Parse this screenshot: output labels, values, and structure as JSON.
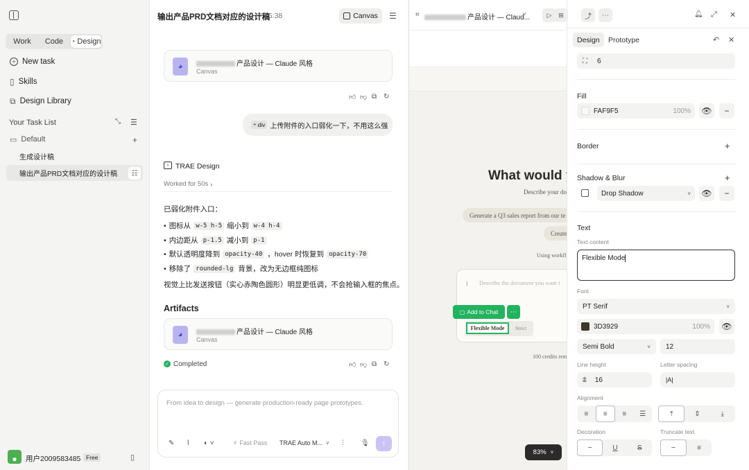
{
  "sidebar": {
    "mode_tabs": [
      "Work",
      "Code",
      "Design"
    ],
    "nav": [
      {
        "icon": "plus-circle-icon",
        "label": "New task"
      },
      {
        "icon": "book-icon",
        "label": "Skills"
      },
      {
        "icon": "library-icon",
        "label": "Design Library"
      }
    ],
    "task_list_title": "Your Task List",
    "group": "Default",
    "tasks": [
      "生成设计稿",
      "输出产品PRD文档对应的设计稿"
    ],
    "user": {
      "name": "用户2009583485",
      "plan": "Free"
    }
  },
  "chat": {
    "title": "输出产品PRD文档对应的设计稿",
    "time": "15:38",
    "canvas_label": "Canvas",
    "artifact_title": "产品设计 — Claude 风格",
    "artifact_sub": "Canvas",
    "user_msg_tag": "div",
    "user_msg": "上传附件的入口弱化一下，不用这么强",
    "agent_name": "TRAE Design",
    "worked": "Worked for 50s",
    "reply_intro": "已弱化附件入口：",
    "bullets": [
      {
        "a": "图标从 ",
        "c1": "w-5 h-5",
        "b": " 缩小到 ",
        "c2": "w-4 h-4",
        "d": ""
      },
      {
        "a": "内边距从 ",
        "c1": "p-1.5",
        "b": " 减小到 ",
        "c2": "p-1",
        "d": ""
      },
      {
        "a": "默认透明度降到 ",
        "c1": "opacity-40",
        "b": "，hover 时恢复到 ",
        "c2": "opacity-70",
        "d": ""
      },
      {
        "a": "移除了 ",
        "c1": "rounded-lg",
        "b": " 背景，改为无边框纯图标",
        "c2": "",
        "d": ""
      }
    ],
    "reply_outro": "视觉上比发送按钮（实心赤陶色圆形）明显更低调，不会抢输入框的焦点。",
    "artifacts_heading": "Artifacts",
    "status": "Completed",
    "input_placeholder": "From idea to design — generate production-ready page prototypes.",
    "fast_pass": "Fast Pass",
    "model": "TRAE Auto M..."
  },
  "canvas": {
    "tab_title": "产品设计 — Claud...",
    "hero": "What would y",
    "hero_sub": "Describe your do",
    "chip1": "Generate a Q3 sales report from our te",
    "chip2": "Create",
    "using": "Using workfl",
    "prompt_placeholder": "Describe the document you want t",
    "add_to_chat": "Add to Chat",
    "mode_selected": "Flexible Mode",
    "mode_other": "Strict",
    "credits": "100 credits rem",
    "zoom": "83%"
  },
  "panel": {
    "tabs": [
      "Design",
      "Prototype"
    ],
    "radius_value": "6",
    "fill_label": "Fill",
    "fill_hex": "FAF9F5",
    "fill_opacity": "100%",
    "border_label": "Border",
    "shadow_label": "Shadow & Blur",
    "shadow_type": "Drop Shadow",
    "text_label": "Text",
    "text_content_label": "Text content",
    "text_content": "Flexible Mode",
    "font_label": "Font",
    "font_family": "PT Serif",
    "text_color_hex": "3D3929",
    "text_color_opacity": "100%",
    "font_weight": "Semi Bold",
    "font_size": "12",
    "line_height_label": "Line height",
    "line_height": "16",
    "letter_spacing_label": "Letter spacing",
    "letter_spacing_icon": "|A|",
    "alignment_label": "Alignment",
    "decoration_label": "Decoration",
    "truncate_label": "Truncate text"
  },
  "colors": {
    "accent_green": "#22b35e",
    "artifact_purple": "#b9b4f0",
    "send_purple": "#c9c4f5",
    "swatch": "#3d3929"
  }
}
